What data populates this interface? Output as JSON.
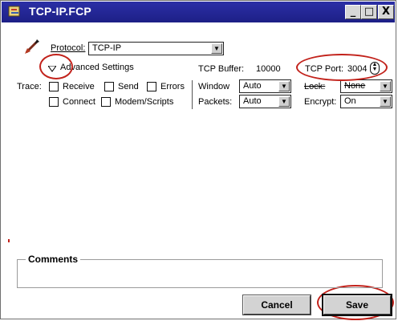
{
  "window": {
    "title": "TCP-IP.FCP",
    "min_glyph": "_",
    "max_glyph": "□",
    "close_glyph": "X"
  },
  "protocol": {
    "label": "Protocol:",
    "value": "TCP-IP"
  },
  "advanced": {
    "label": "Advanced Settings",
    "buffer_label": "TCP Buffer:",
    "buffer_value": "10000",
    "port_label": "TCP Port:",
    "port_value": "3004"
  },
  "trace": {
    "label": "Trace:",
    "options": [
      "Receive",
      "Send",
      "Errors",
      "Connect",
      "Modem/Scripts"
    ]
  },
  "window_setting": {
    "label": "Window",
    "value": "Auto"
  },
  "packets_setting": {
    "label": "Packets:",
    "value": "Auto"
  },
  "lock_setting": {
    "label": "Lock:",
    "value": "None"
  },
  "encrypt_setting": {
    "label": "Encrypt:",
    "value": "On"
  },
  "comments": {
    "title": "Comments"
  },
  "buttons": {
    "cancel": "Cancel",
    "save": "Save"
  },
  "colors": {
    "titlebar": "#1f2190",
    "annotation": "#c2221b",
    "button_face": "#d3d3d3"
  }
}
